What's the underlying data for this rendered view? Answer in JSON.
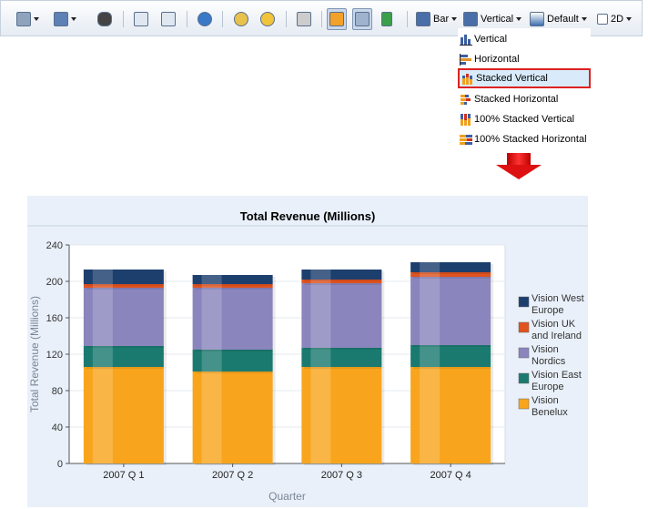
{
  "toolbar": {
    "bar_label": "Bar",
    "vertical_label": "Vertical",
    "default_label": "Default",
    "dim_label": "2D",
    "icons": [
      "print-icon",
      "export-icon",
      "binoculars-icon",
      "drill-icon",
      "page-layout-icon",
      "refresh-icon",
      "format-icon",
      "help-icon",
      "calculator-icon",
      "chart-type-icon",
      "swap-axes-icon",
      "sort-icon",
      "bar-chart-icon",
      "vertical-chart-icon",
      "default-style-icon",
      "2d-icon"
    ]
  },
  "menu": {
    "items": [
      {
        "label": "Vertical"
      },
      {
        "label": "Horizontal"
      },
      {
        "label": "Stacked Vertical",
        "selected": true
      },
      {
        "label": "Stacked Horizontal"
      },
      {
        "label": "100% Stacked Vertical"
      },
      {
        "label": "100% Stacked Horizontal"
      }
    ]
  },
  "colors": {
    "benelux": "#f8a51d",
    "east_europe": "#1b7a6f",
    "nordics": "#8a85bd",
    "uk_ireland": "#e0521e",
    "west_europe": "#1d3f6e",
    "highlight": "#dd2222"
  },
  "chart_data": {
    "type": "bar",
    "stacked": true,
    "title": "Total Revenue (Millions)",
    "xlabel": "Quarter",
    "ylabel": "Total Revenue (Millions)",
    "ylim": [
      0,
      240
    ],
    "yticks": [
      0,
      40,
      80,
      120,
      160,
      200,
      240
    ],
    "categories": [
      "2007 Q 1",
      "2007 Q 2",
      "2007 Q 3",
      "2007 Q 4"
    ],
    "legend_position": "right",
    "series": [
      {
        "name": "Vision Benelux",
        "values": [
          106,
          101,
          106,
          106
        ]
      },
      {
        "name": "Vision East Europe",
        "values": [
          23,
          24,
          21,
          24
        ]
      },
      {
        "name": "Vision Nordics",
        "values": [
          64,
          68,
          71,
          75
        ]
      },
      {
        "name": "Vision UK and Ireland",
        "values": [
          4,
          4,
          4,
          5
        ]
      },
      {
        "name": "Vision West Europe",
        "values": [
          16,
          10,
          11,
          11
        ]
      }
    ]
  }
}
